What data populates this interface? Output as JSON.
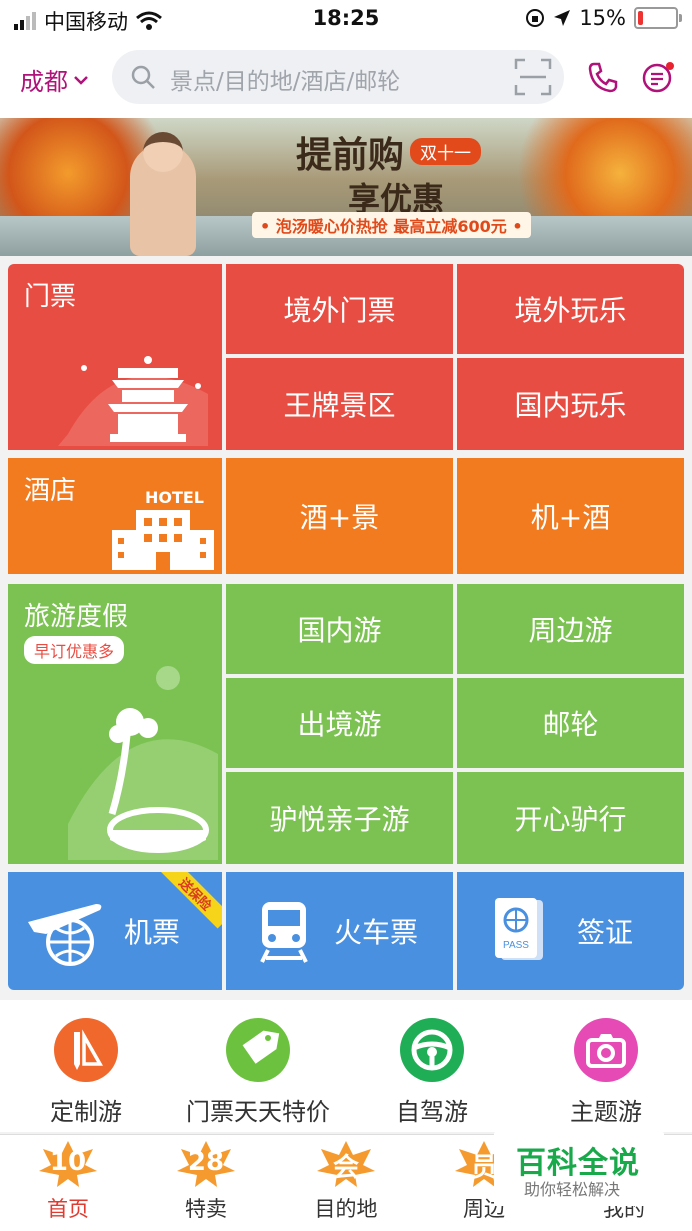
{
  "status_bar": {
    "carrier": "中国移动",
    "time": "18:25",
    "battery": "15%",
    "battery_level": 0.15
  },
  "header": {
    "city": "成都",
    "search_placeholder": "景点/目的地/酒店/邮轮"
  },
  "banner": {
    "title": "提前购",
    "tag": "双十一",
    "subtitle": "享优惠",
    "line": "• 泡汤暖心价热抢 最高立减600元 •"
  },
  "sections": {
    "tickets": {
      "title": "门票",
      "items": [
        "境外门票",
        "境外玩乐",
        "王牌景区",
        "国内玩乐"
      ]
    },
    "hotel": {
      "title": "酒店",
      "badge": "HOTEL",
      "items": [
        "酒+景",
        "机+酒"
      ]
    },
    "vacation": {
      "title": "旅游度假",
      "pill": "早订优惠多",
      "items": [
        "国内游",
        "周边游",
        "出境游",
        "邮轮",
        "驴悦亲子游",
        "开心驴行"
      ]
    },
    "transport": {
      "flight": "机票",
      "flight_corner": "送保险",
      "train": "火车票",
      "visa": "签证",
      "passport_text": "PASS"
    }
  },
  "quick": [
    {
      "label": "定制游",
      "color": "#f0682c",
      "icon": "ruler-pencil-icon"
    },
    {
      "label": "门票天天特价",
      "color": "#6cc23e",
      "icon": "sale-tag-icon"
    },
    {
      "label": "自驾游",
      "color": "#1fae55",
      "icon": "steering-wheel-icon"
    },
    {
      "label": "主题游",
      "color": "#e64ab4",
      "icon": "camera-icon"
    }
  ],
  "tabbar": [
    {
      "label": "首页",
      "num": "10"
    },
    {
      "label": "特卖",
      "num": "28"
    },
    {
      "label": "目的地",
      "num": "会"
    },
    {
      "label": "周边",
      "num": "员"
    },
    {
      "label": "我的",
      "num": ""
    }
  ],
  "watermark": {
    "main": "百科全说",
    "sub": "助你轻松解决"
  }
}
